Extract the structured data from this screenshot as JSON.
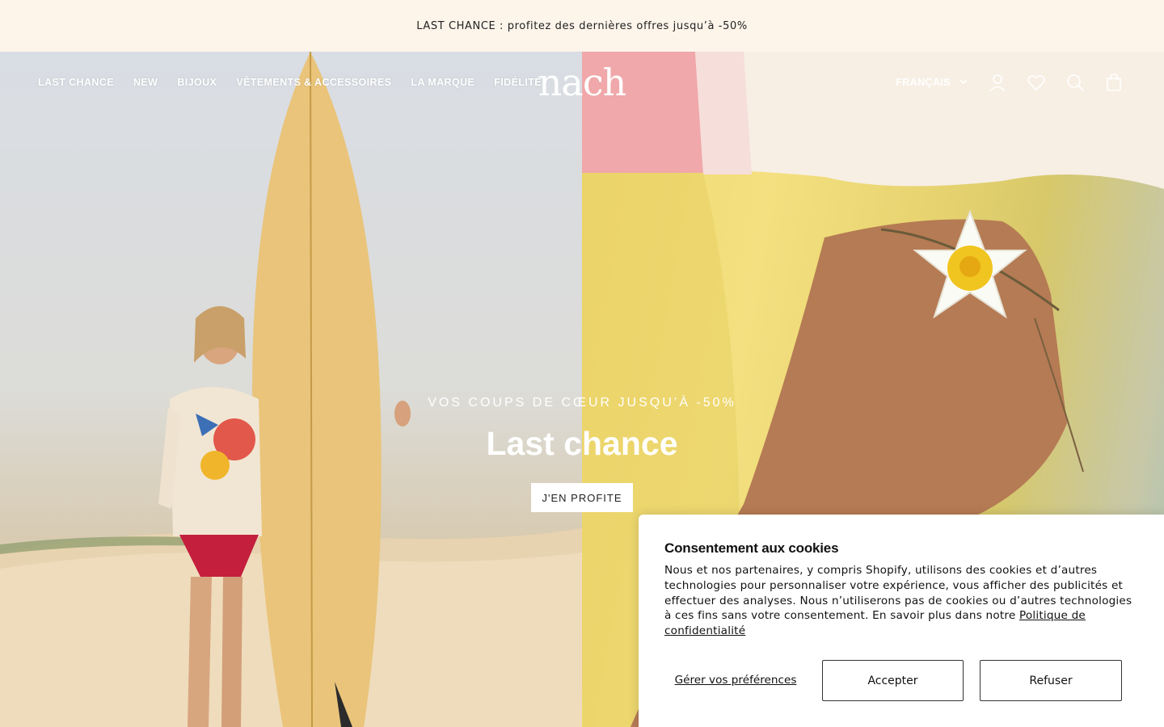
{
  "announcement": "LAST CHANCE : profitez des dernières offres jusqu’à -50%",
  "nav": {
    "items": [
      "LAST CHANCE",
      "NEW",
      "BIJOUX",
      "VÊTEMENTS & ACCESSOIRES",
      "LA MARQUE",
      "FIDÉLITÉ"
    ],
    "logo": "nach",
    "language": "FRANÇAIS",
    "icons": [
      "chevron-down-icon",
      "account-icon",
      "heart-icon",
      "search-icon",
      "bag-icon"
    ]
  },
  "hero": {
    "eyebrow": "VOS COUPS DE CŒUR JUSQU’À -50%",
    "title": "Last chance",
    "cta": "J'EN PROFITE"
  },
  "cookie": {
    "title": "Consentement aux cookies",
    "body": "Nous et nos partenaires, y compris Shopify, utilisons des cookies et d’autres technologies pour personnaliser votre expérience, vous afficher des publicités et effectuer des analyses. Nous n’utiliserons pas de cookies ou d’autres technologies à ces fins sans votre consentement. En savoir plus dans notre ",
    "link": "Politique de confidentialité",
    "manage": "Gérer vos préférences",
    "accept": "Accepter",
    "refuse": "Refuser"
  }
}
